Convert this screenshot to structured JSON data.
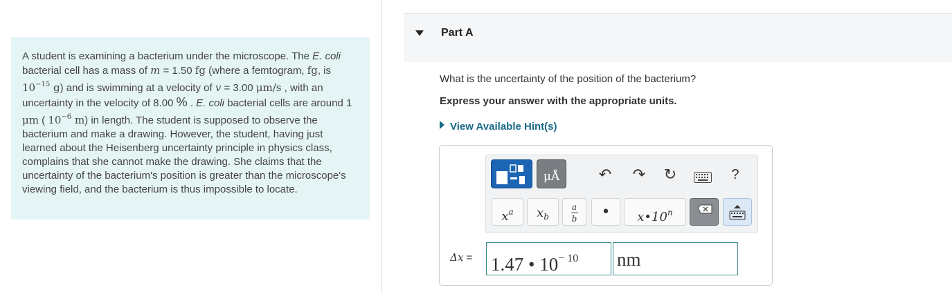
{
  "problem": {
    "t1": "A student is examining a bacterium under the microscope. The ",
    "t1_italic": "E. coli",
    "t2": " bacterial cell has a mass of ",
    "m_var": "m",
    "t3": " = 1.50 ",
    "fg": "fg",
    "t4": " (where a femtogram, ",
    "fg2": "fg",
    "t5": ", is ",
    "ten1": "10",
    "exp1": "−15",
    "g": " g",
    "t6": ") and is swimming at a velocity of ",
    "v_var": "v",
    "t7": " = 3.00 ",
    "um_s": "μm/s",
    "t8": " , with an uncertainty in the velocity of 8.00 ",
    "pct": "%",
    "t9": " . ",
    "t9_italic": "E. coli",
    "t10": " bacterial cells are around 1 ",
    "um": "μm",
    "t11": " ( ",
    "ten2": "10",
    "exp2": "−6",
    "m_unit": " m",
    "t12": ") in length. The student is supposed to observe the bacterium and make a drawing. However, the student, having just learned about the Heisenberg uncertainty principle in physics class, complains that she cannot make the drawing. She claims that the uncertainty of the bacterium's position is greater than the microscope's viewing field, and the bacterium is thus impossible to locate."
  },
  "part": {
    "title": "Part A"
  },
  "question": "What is the uncertainty of the position of the bacterium?",
  "instruction": "Express your answer with the appropriate units.",
  "hint_link": "View Available Hint(s)",
  "toolbar": {
    "units_label": "μÅ",
    "undo_glyph": "↶",
    "redo_glyph": "↷",
    "reset_glyph": "↻",
    "help_label": "?",
    "key_sup_base": "x",
    "key_sup_exp": "a",
    "key_sub_base": "x",
    "key_sub_sub": "b",
    "key_frac_num": "a",
    "key_frac_den": "b",
    "key_dot": "•",
    "key_sci": "x•10",
    "key_sci_exp": "n"
  },
  "answer": {
    "label_var": "Δx",
    "label_eq": " =",
    "value_mantissa": "1.47 • 10",
    "value_exp": "− 10",
    "units": "nm"
  }
}
